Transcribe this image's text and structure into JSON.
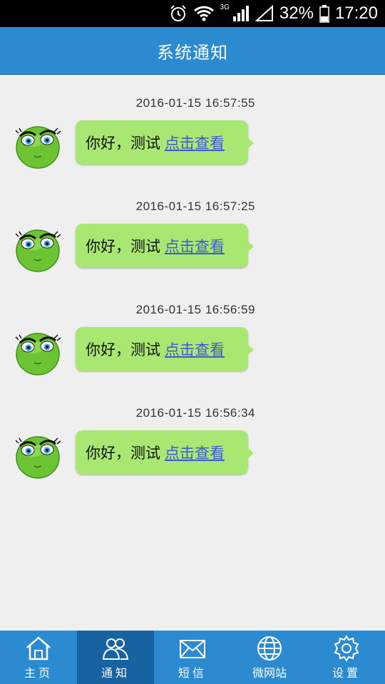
{
  "status_bar": {
    "battery": "32%",
    "time": "17:20",
    "network": "3G"
  },
  "header": {
    "title": "系统通知"
  },
  "messages": [
    {
      "time": "2016-01-15 16:57:55",
      "text": "你好，测试",
      "link": "点击查看"
    },
    {
      "time": "2016-01-15 16:57:25",
      "text": "你好，测试",
      "link": "点击查看"
    },
    {
      "time": "2016-01-15 16:56:59",
      "text": "你好，测试",
      "link": "点击查看"
    },
    {
      "time": "2016-01-15 16:56:34",
      "text": "你好，测试",
      "link": "点击查看"
    }
  ],
  "tabs": [
    {
      "label": "主页",
      "icon": "home-icon",
      "active": false
    },
    {
      "label": "通知",
      "icon": "people-icon",
      "active": true
    },
    {
      "label": "短信",
      "icon": "envelope-icon",
      "active": false
    },
    {
      "label": "微网站",
      "icon": "globe-icon",
      "active": false
    },
    {
      "label": "设置",
      "icon": "gear-icon",
      "active": false
    }
  ],
  "colors": {
    "header": "#2b8ad0",
    "tab_active": "#1762a0",
    "bubble": "#a8e872",
    "link": "#3b5bd6"
  }
}
